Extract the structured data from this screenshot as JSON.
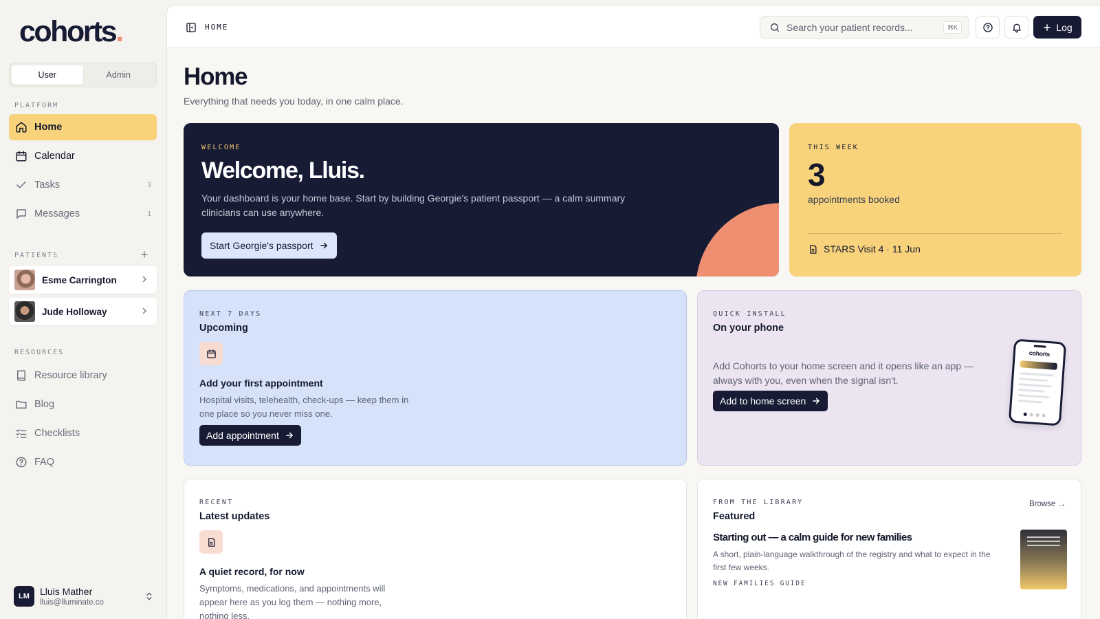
{
  "app": {
    "logo": "cohorts",
    "logo_dot": "."
  },
  "sidebar": {
    "role_switch": {
      "user": "User",
      "admin": "Admin",
      "active": "User"
    },
    "platform_label": "PLATFORM",
    "platform_items": [
      {
        "label": "Home",
        "icon": "home-icon",
        "active": true
      },
      {
        "label": "Calendar",
        "icon": "calendar-icon"
      },
      {
        "label": "Tasks",
        "icon": "check-icon",
        "count": "3"
      },
      {
        "label": "Messages",
        "icon": "message-icon",
        "count": "1"
      }
    ],
    "patients_label": "PATIENTS",
    "patients": [
      {
        "name": "Esme Carrington"
      },
      {
        "name": "Jude Holloway"
      }
    ],
    "resources_label": "RESOURCES",
    "resource_items": [
      {
        "label": "Resource library",
        "icon": "book-icon"
      },
      {
        "label": "Blog",
        "icon": "folder-icon"
      },
      {
        "label": "Checklists",
        "icon": "checklist-icon"
      },
      {
        "label": "FAQ",
        "icon": "help-circle-icon"
      }
    ],
    "user": {
      "initials": "LM",
      "name": "Lluis Mather",
      "email": "lluis@lluminate.co"
    }
  },
  "topbar": {
    "breadcrumb": "HOME",
    "search_placeholder": "Search your patient records...",
    "search_shortcut": "⌘K",
    "log_label": "Log"
  },
  "page": {
    "title": "Home",
    "subtitle": "Everything that needs you today, in one calm place."
  },
  "welcome": {
    "eyebrow": "WELCOME",
    "title": "Welcome, Lluis.",
    "body": "Your dashboard is your home base. Start by building Georgie's patient passport — a calm summary clinicians can use anywhere.",
    "cta": "Start Georgie's passport"
  },
  "this_week": {
    "eyebrow": "THIS WEEK",
    "count": "3",
    "label": "appointments booked",
    "item": "STARS Visit 4 · 11 Jun"
  },
  "upcoming": {
    "eyebrow": "NEXT 7 DAYS",
    "title": "Upcoming",
    "empty_title": "Add your first appointment",
    "empty_body": "Hospital visits, telehealth, check-ups — keep them in one place so you never miss one.",
    "cta": "Add appointment"
  },
  "quick_install": {
    "eyebrow": "QUICK INSTALL",
    "title": "On your phone",
    "body": "Add Cohorts to your home screen and it opens like an app — always with you, even when the signal isn't.",
    "cta": "Add to home screen",
    "phone_label": "cohorts"
  },
  "recent": {
    "eyebrow": "RECENT",
    "title": "Latest updates",
    "empty_title": "A quiet record, for now",
    "empty_body": "Symptoms, medications, and appointments will appear here as you log them — nothing more, nothing less."
  },
  "featured": {
    "eyebrow": "FROM THE LIBRARY",
    "title": "Featured",
    "browse": "Browse →",
    "article_title": "Starting out — a calm guide for new families",
    "article_desc": "A short, plain-language walkthrough of the registry and what to expect in the first few weeks.",
    "tag": "NEW FAMILIES GUIDE"
  },
  "colors": {
    "navy": "#171b34",
    "yellow": "#f8d37c",
    "coral": "#ee8f72",
    "blue_card": "#d5e2fa",
    "lavender_card": "#ece4f1"
  }
}
